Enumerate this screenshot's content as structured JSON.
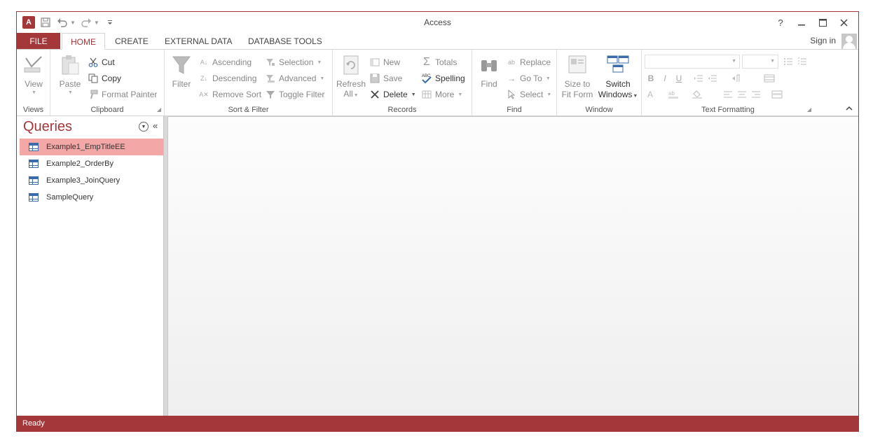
{
  "app": {
    "title": "Access",
    "logo_letter": "A",
    "help": "?",
    "sign_in": "Sign in",
    "accent": "#a4373a"
  },
  "qat": {
    "save_icon": "save-icon",
    "undo_icon": "undo-icon",
    "redo_icon": "redo-icon",
    "customize_icon": "customize-qat-icon"
  },
  "tabs": [
    "FILE",
    "HOME",
    "CREATE",
    "EXTERNAL DATA",
    "DATABASE TOOLS"
  ],
  "ribbon": {
    "views": {
      "label": "Views",
      "view": "View"
    },
    "clipboard": {
      "label": "Clipboard",
      "paste": "Paste",
      "cut": "Cut",
      "copy": "Copy",
      "format_painter": "Format Painter"
    },
    "sort_filter": {
      "label": "Sort & Filter",
      "filter": "Filter",
      "ascending": "Ascending",
      "descending": "Descending",
      "remove_sort": "Remove Sort",
      "selection": "Selection",
      "advanced": "Advanced",
      "toggle_filter": "Toggle Filter"
    },
    "records": {
      "label": "Records",
      "refresh": "Refresh",
      "refresh_all": "All",
      "new": "New",
      "save": "Save",
      "delete": "Delete",
      "totals": "Totals",
      "spelling": "Spelling",
      "more": "More"
    },
    "find": {
      "label": "Find",
      "find": "Find",
      "replace": "Replace",
      "go_to": "Go To",
      "select": "Select"
    },
    "window": {
      "label": "Window",
      "size_to_fit_1": "Size to",
      "size_to_fit_2": "Fit Form",
      "switch_1": "Switch",
      "switch_2": "Windows"
    },
    "text_formatting": {
      "label": "Text Formatting",
      "bold": "B",
      "italic": "I",
      "underline": "U"
    }
  },
  "nav": {
    "title": "Queries",
    "items": [
      {
        "label": "Example1_EmpTitleEE",
        "selected": true
      },
      {
        "label": "Example2_OrderBy",
        "selected": false
      },
      {
        "label": "Example3_JoinQuery",
        "selected": false
      },
      {
        "label": "SampleQuery",
        "selected": false
      }
    ]
  },
  "status": {
    "text": "Ready"
  }
}
